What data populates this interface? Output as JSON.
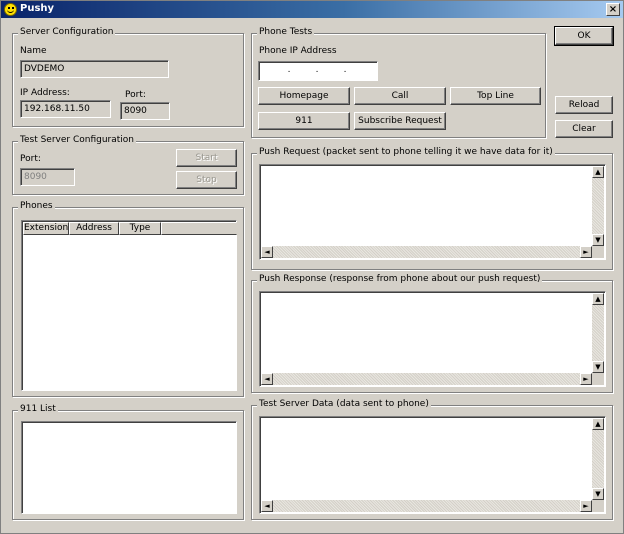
{
  "window": {
    "title": "Pushy",
    "close_glyph": "×",
    "icon": "smiley-icon"
  },
  "server_config": {
    "legend": "Server Configuration",
    "name_label": "Name",
    "name_value": "DVDEMO",
    "ip_label": "IP Address:",
    "ip_value": "192.168.11.50",
    "port_label": "Port:",
    "port_value": "8090"
  },
  "test_server": {
    "legend": "Test Server Configuration",
    "port_label": "Port:",
    "port_value": "8090",
    "start_label": "Start",
    "stop_label": "Stop"
  },
  "phones": {
    "legend": "Phones",
    "columns": [
      "Extension",
      "Address",
      "Type"
    ]
  },
  "list_911": {
    "legend": "911 List"
  },
  "phone_tests": {
    "legend": "Phone Tests",
    "ip_label": "Phone IP Address",
    "ip_dots": [
      ".",
      ".",
      "."
    ],
    "homepage_label": "Homepage",
    "call_label": "Call",
    "topline_label": "Top Line",
    "b911_label": "911",
    "subscribe_label": "Subscribe Request"
  },
  "side_buttons": {
    "ok_label": "OK",
    "reload_label": "Reload",
    "clear_label": "Clear"
  },
  "push_request": {
    "legend": "Push Request (packet sent to phone telling it we have data for it)"
  },
  "push_response": {
    "legend": "Push Response (response from phone about our push request)"
  },
  "test_server_data": {
    "legend": "Test Server Data (data sent to phone)"
  },
  "scroll_glyphs": {
    "up": "▲",
    "down": "▼",
    "left": "◄",
    "right": "►"
  }
}
